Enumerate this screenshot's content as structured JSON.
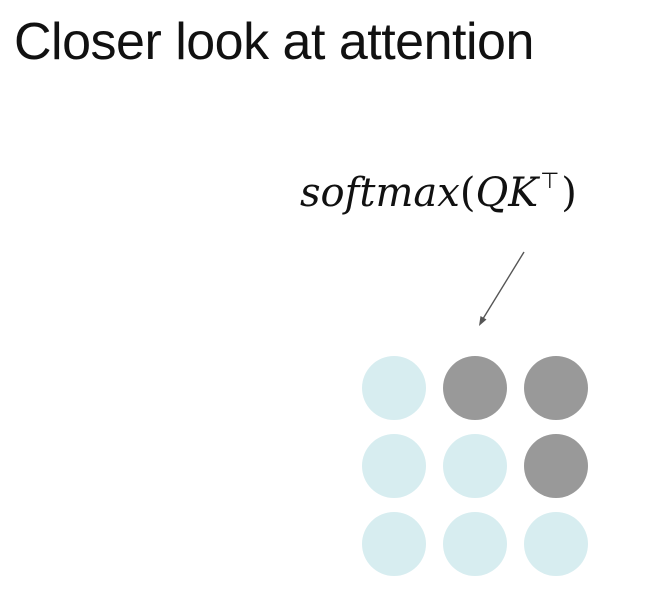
{
  "title": "Closer look at attention",
  "formula": {
    "func": "softmax",
    "open": "(",
    "q": "Q",
    "k": "K",
    "superscript": "⊤",
    "close": ")"
  },
  "colors": {
    "masked": "#999999",
    "visible": "#d7edf0",
    "arrow": "#555555"
  },
  "attention_matrix": [
    [
      "visible",
      "masked",
      "masked"
    ],
    [
      "visible",
      "visible",
      "masked"
    ],
    [
      "visible",
      "visible",
      "visible"
    ]
  ]
}
